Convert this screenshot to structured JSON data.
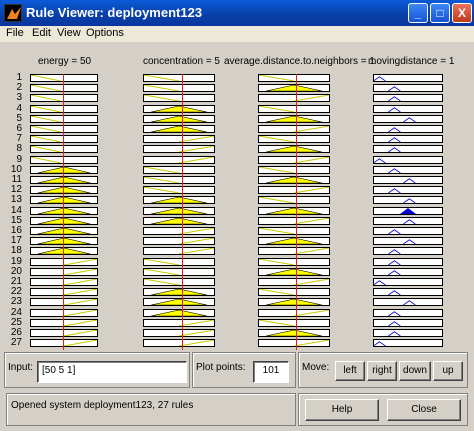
{
  "window": {
    "title": "Rule Viewer: deployment123"
  },
  "title_buttons": {
    "minimize": "_",
    "maximize": "□",
    "close": "X"
  },
  "menu": [
    "File",
    "Edit",
    "View",
    "Options"
  ],
  "variables": [
    {
      "header": "energy = 50",
      "kind": "input"
    },
    {
      "header": "concentration = 5",
      "kind": "input"
    },
    {
      "header": "average.distance.to.neighbors = 1",
      "kind": "input"
    },
    {
      "header": "movingdistance = 1",
      "kind": "output"
    }
  ],
  "rows": [
    "1",
    "2",
    "3",
    "4",
    "5",
    "6",
    "7",
    "8",
    "9",
    "10",
    "11",
    "12",
    "13",
    "14",
    "15",
    "16",
    "17",
    "18",
    "19",
    "20",
    "21",
    "22",
    "23",
    "24",
    "25",
    "26",
    "27"
  ],
  "rules": [
    {
      "e": "low",
      "c": "low",
      "a": "low",
      "o": "vlow"
    },
    {
      "e": "low",
      "c": "low",
      "a": "med",
      "o": "low"
    },
    {
      "e": "low",
      "c": "low",
      "a": "high",
      "o": "low"
    },
    {
      "e": "low",
      "c": "med",
      "a": "low",
      "o": "low"
    },
    {
      "e": "low",
      "c": "med",
      "a": "med",
      "o": "mid"
    },
    {
      "e": "low",
      "c": "med",
      "a": "high",
      "o": "low"
    },
    {
      "e": "low",
      "c": "high",
      "a": "low",
      "o": "low"
    },
    {
      "e": "low",
      "c": "high",
      "a": "med",
      "o": "low"
    },
    {
      "e": "low",
      "c": "high",
      "a": "high",
      "o": "vlow"
    },
    {
      "e": "med",
      "c": "low",
      "a": "low",
      "o": "low"
    },
    {
      "e": "med",
      "c": "low",
      "a": "med",
      "o": "mid"
    },
    {
      "e": "med",
      "c": "low",
      "a": "high",
      "o": "low"
    },
    {
      "e": "med",
      "c": "med",
      "a": "low",
      "o": "mid"
    },
    {
      "e": "med",
      "c": "med",
      "a": "med",
      "o": "high"
    },
    {
      "e": "med",
      "c": "med",
      "a": "high",
      "o": "mid"
    },
    {
      "e": "med",
      "c": "high",
      "a": "low",
      "o": "low"
    },
    {
      "e": "med",
      "c": "high",
      "a": "med",
      "o": "mid"
    },
    {
      "e": "med",
      "c": "high",
      "a": "high",
      "o": "low"
    },
    {
      "e": "high",
      "c": "low",
      "a": "low",
      "o": "low"
    },
    {
      "e": "high",
      "c": "low",
      "a": "med",
      "o": "low"
    },
    {
      "e": "high",
      "c": "low",
      "a": "high",
      "o": "vlow"
    },
    {
      "e": "high",
      "c": "med",
      "a": "low",
      "o": "low"
    },
    {
      "e": "high",
      "c": "med",
      "a": "med",
      "o": "mid"
    },
    {
      "e": "high",
      "c": "med",
      "a": "high",
      "o": "low"
    },
    {
      "e": "high",
      "c": "high",
      "a": "low",
      "o": "low"
    },
    {
      "e": "high",
      "c": "high",
      "a": "med",
      "o": "low"
    },
    {
      "e": "high",
      "c": "high",
      "a": "high",
      "o": "vlow"
    }
  ],
  "input_panel": {
    "label": "Input:",
    "value": "[50 5 1]"
  },
  "plot_panel": {
    "label": "Plot points:",
    "value": "101"
  },
  "move_panel": {
    "label": "Move:",
    "buttons": [
      "left",
      "right",
      "down",
      "up"
    ]
  },
  "status_text": "Opened system deployment123, 27 rules",
  "help_label": "Help",
  "close_label": "Close",
  "colors": {
    "fill": "#ffff00",
    "outline": "#000000",
    "mf": "#c8c800",
    "output": "#0000cc",
    "marker": "#e02010",
    "titlebar": "#0a47c0"
  }
}
